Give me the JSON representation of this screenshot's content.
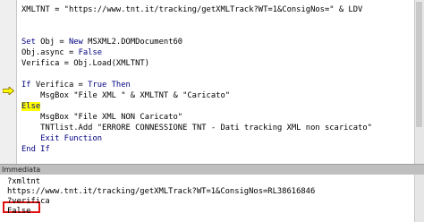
{
  "editor": {
    "lines": [
      {
        "parts": [
          {
            "t": "XMLTNT = \"https://www.tnt.it/tracking/getXMLTrack?WT=1&ConsigNos=\" & LDV",
            "k": "n"
          }
        ]
      },
      {
        "parts": [
          {
            "t": "",
            "k": "n"
          }
        ]
      },
      {
        "parts": [
          {
            "t": "",
            "k": "n"
          }
        ]
      },
      {
        "parts": [
          {
            "t": "Set",
            "k": "kw"
          },
          {
            "t": " Obj = ",
            "k": "n"
          },
          {
            "t": "New",
            "k": "kw"
          },
          {
            "t": " MSXML2.DOMDocument60",
            "k": "n"
          }
        ]
      },
      {
        "parts": [
          {
            "t": "Obj.async = ",
            "k": "n"
          },
          {
            "t": "False",
            "k": "kw"
          }
        ]
      },
      {
        "parts": [
          {
            "t": "Verifica = Obj.Load(XMLTNT)",
            "k": "n"
          }
        ]
      },
      {
        "parts": [
          {
            "t": "",
            "k": "n"
          }
        ]
      },
      {
        "parts": [
          {
            "t": "If",
            "k": "kw"
          },
          {
            "t": " Verifica = ",
            "k": "n"
          },
          {
            "t": "True",
            "k": "kw"
          },
          {
            "t": " ",
            "k": "n"
          },
          {
            "t": "Then",
            "k": "kw"
          }
        ]
      },
      {
        "parts": [
          {
            "t": "    MsgBox \"File XML \" & XMLTNT & \"Caricato\"",
            "k": "n"
          }
        ]
      },
      {
        "parts": [
          {
            "t": "Else",
            "k": "hl"
          }
        ]
      },
      {
        "parts": [
          {
            "t": "    MsgBox \"File XML NON Caricato\"",
            "k": "n"
          }
        ]
      },
      {
        "parts": [
          {
            "t": "    TNTlist.Add \"ERRORE CONNESSIONE TNT - Dati tracking XML non scaricato\"",
            "k": "n"
          }
        ]
      },
      {
        "parts": [
          {
            "t": "    ",
            "k": "n"
          },
          {
            "t": "Exit Function",
            "k": "kw"
          }
        ]
      },
      {
        "parts": [
          {
            "t": "End If",
            "k": "kw"
          }
        ]
      }
    ]
  },
  "immediate": {
    "title": "Immediata",
    "lines": [
      "?xmltnt",
      "https://www.tnt.it/tracking/getXMLTrack?WT=1&ConsigNos=RL38616846",
      "?verifica",
      "False"
    ]
  },
  "icons": {
    "execution_pointer": "execution-arrow-icon"
  },
  "colors": {
    "keyword": "#000080",
    "highlight": "#ffff00",
    "marker": "#e01010"
  }
}
